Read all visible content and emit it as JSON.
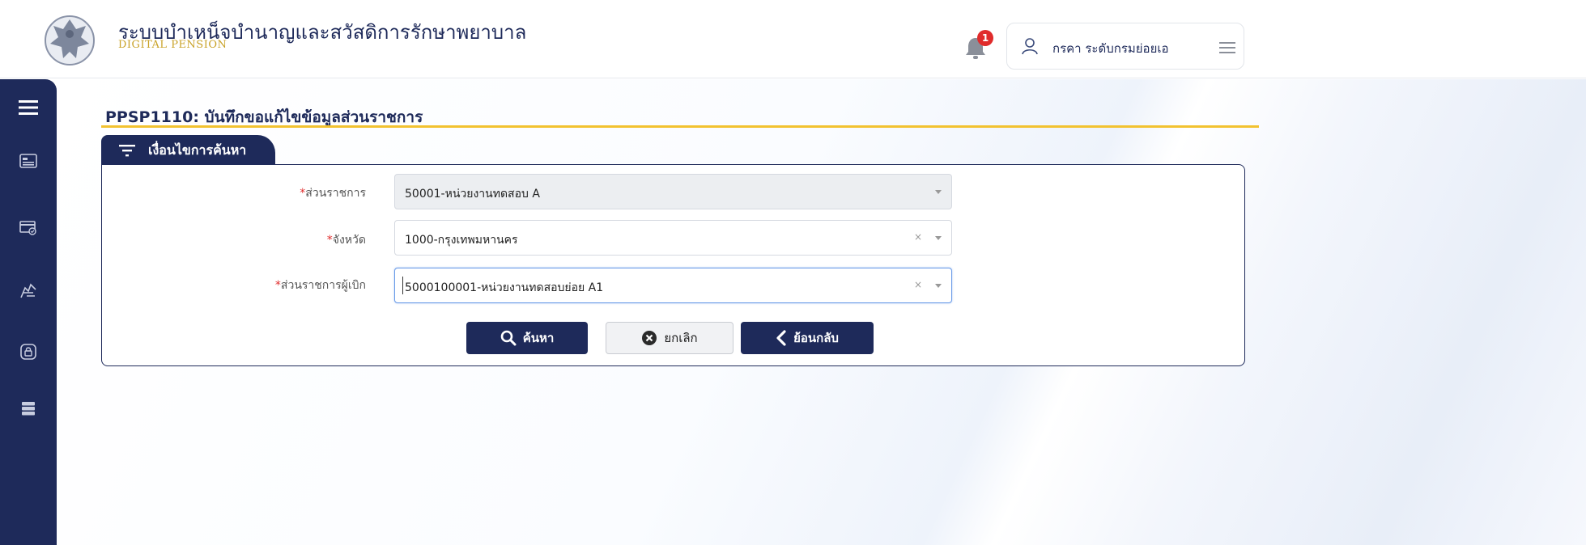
{
  "header": {
    "app_title": "ระบบบำเหน็จบำนาญและสวัสดิการรักษาพยาบาล",
    "app_subtitle": "DIGITAL PENSION",
    "notification_count": "1",
    "user_name": "กรคา ระดับกรมย่อยเอ",
    "icons": [
      "garuda-logo",
      "bell-icon",
      "user-icon",
      "hamburger-icon"
    ]
  },
  "sidebar": {
    "icons": [
      "hamburger-icon",
      "id-card-icon",
      "payment-icon",
      "money-hand-icon",
      "lock-icon",
      "server-icon"
    ]
  },
  "page": {
    "title": "PPSP1110: บันทึกขอแก้ไขข้อมูลส่วนราชการ",
    "search_tab_label": "เงื่อนไขการค้นหา"
  },
  "form": {
    "fields": [
      {
        "label": "ส่วนราชการ",
        "required_mark": "*",
        "value": "50001-หน่วยงานทดสอบ A"
      },
      {
        "label": "จังหวัด",
        "required_mark": "*",
        "value": "1000-กรุงเทพมหานคร",
        "clear": "×"
      },
      {
        "label": "ส่วนราชการผู้เบิก",
        "required_mark": "*",
        "value": "5000100001-หน่วยงานทดสอบย่อย A1",
        "clear": "×"
      }
    ]
  },
  "buttons": {
    "search": "ค้นหา",
    "cancel": "ยกเลิก",
    "back": "ย้อนกลับ"
  },
  "colors": {
    "primary": "#1e2a5a",
    "accent_line": "#f2c230",
    "badge": "#e02b2b"
  }
}
